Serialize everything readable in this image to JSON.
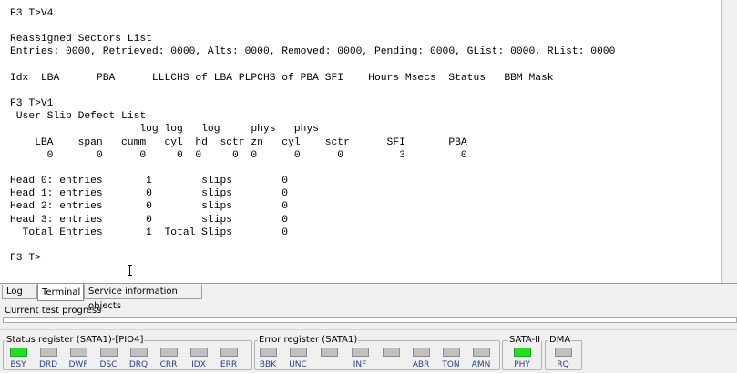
{
  "terminal": {
    "lines": [
      "F3 T>V4",
      "",
      "Reassigned Sectors List",
      "Entries: 0000, Retrieved: 0000, Alts: 0000, Removed: 0000, Pending: 0000, GList: 0000, RList: 0000",
      "",
      "Idx  LBA      PBA      LLLCHS of LBA PLPCHS of PBA SFI    Hours Msecs  Status   BBM Mask",
      "",
      "F3 T>V1",
      " User Slip Defect List",
      "                     log log   log     phys   phys",
      "    LBA    span   cumm   cyl  hd  sctr zn   cyl    sctr      SFI       PBA",
      "      0       0      0     0  0     0  0      0      0         3         0",
      "",
      "Head 0: entries       1        slips        0",
      "Head 1: entries       0        slips        0",
      "Head 2: entries       0        slips        0",
      "Head 3: entries       0        slips        0",
      "  Total Entries       1  Total Slips        0",
      "",
      "F3 T>"
    ]
  },
  "tabs": [
    {
      "label": "Log",
      "active": false
    },
    {
      "label": "Terminal",
      "active": true
    },
    {
      "label": "Service information objects",
      "active": false
    }
  ],
  "progress": {
    "label": "Current test progress",
    "value": 0
  },
  "status_groups": [
    {
      "title": "Status register (SATA1)-[PIO4]",
      "leds": [
        {
          "label": "BSY",
          "on": true
        },
        {
          "label": "DRD",
          "on": false
        },
        {
          "label": "DWF",
          "on": false
        },
        {
          "label": "DSC",
          "on": false
        },
        {
          "label": "DRQ",
          "on": false
        },
        {
          "label": "CRR",
          "on": false
        },
        {
          "label": "IDX",
          "on": false
        },
        {
          "label": "ERR",
          "on": false
        }
      ]
    },
    {
      "title": "Error register (SATA1)",
      "leds": [
        {
          "label": "BBK",
          "on": false
        },
        {
          "label": "UNC",
          "on": false
        },
        {
          "label": "",
          "on": false
        },
        {
          "label": "INF",
          "on": false
        },
        {
          "label": "",
          "on": false
        },
        {
          "label": "ABR",
          "on": false
        },
        {
          "label": "TON",
          "on": false
        },
        {
          "label": "AMN",
          "on": false
        }
      ]
    },
    {
      "title": "SATA-II",
      "leds": [
        {
          "label": "PHY",
          "on": true
        }
      ]
    },
    {
      "title": "DMA",
      "leds": [
        {
          "label": "RQ",
          "on": false
        }
      ]
    }
  ],
  "colors": {
    "led_on": "#20e020",
    "led_off": "#c0c0c0",
    "label_blue": "#2c3e8c"
  }
}
